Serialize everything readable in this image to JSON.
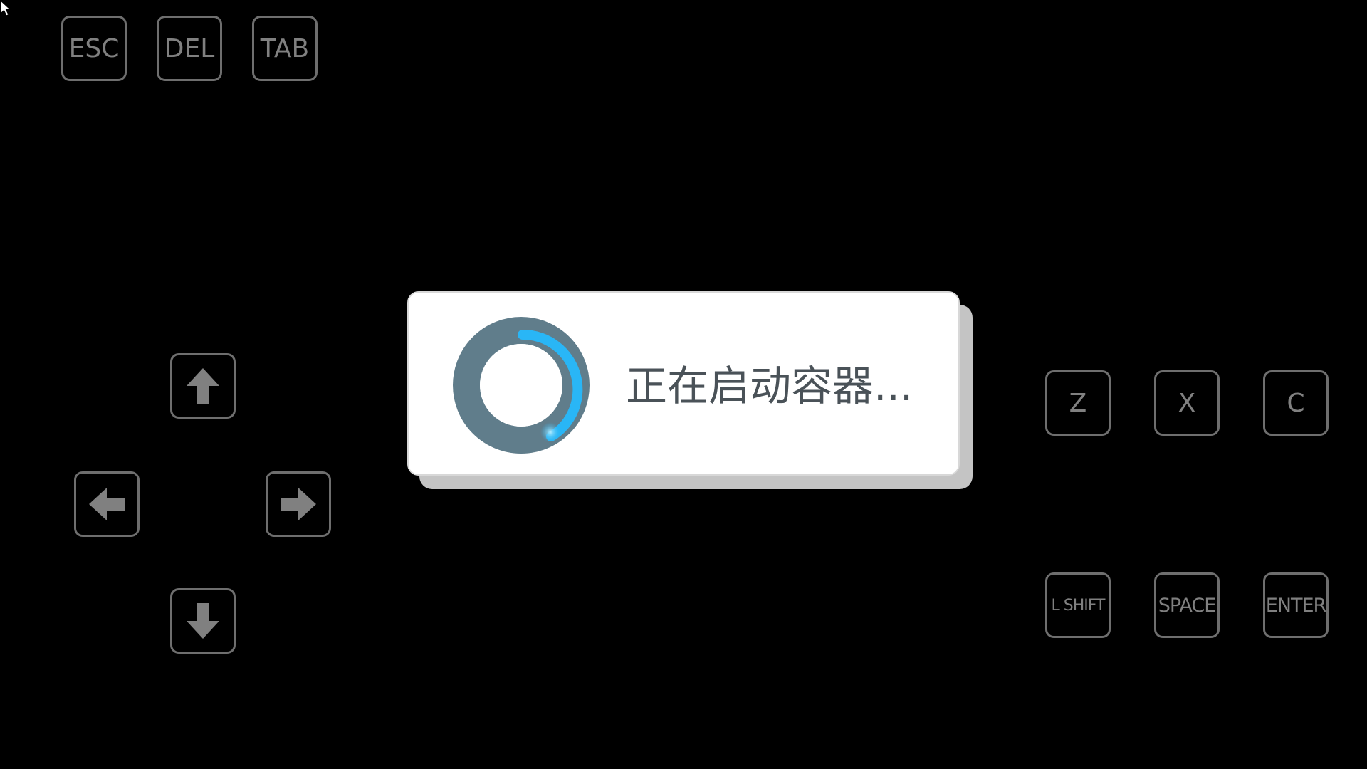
{
  "keys": {
    "esc": "ESC",
    "del": "DEL",
    "tab": "TAB",
    "up": "arrow-up-icon",
    "left": "arrow-left-icon",
    "right": "arrow-right-icon",
    "down": "arrow-down-icon",
    "z": "Z",
    "x": "X",
    "c": "C",
    "lshift": "L SHIFT",
    "space": "SPACE",
    "enter": "ENTER"
  },
  "dialog": {
    "message": "正在启动容器..."
  },
  "colors": {
    "background": "#000000",
    "key_outline": "#6e6e6e",
    "key_label": "#808080",
    "dialog_bg": "#ffffff",
    "dialog_shadow": "#c4c4c4",
    "spinner_ring": "#607d8b",
    "spinner_accent": "#29b6f6",
    "message_text": "#4a5258"
  }
}
